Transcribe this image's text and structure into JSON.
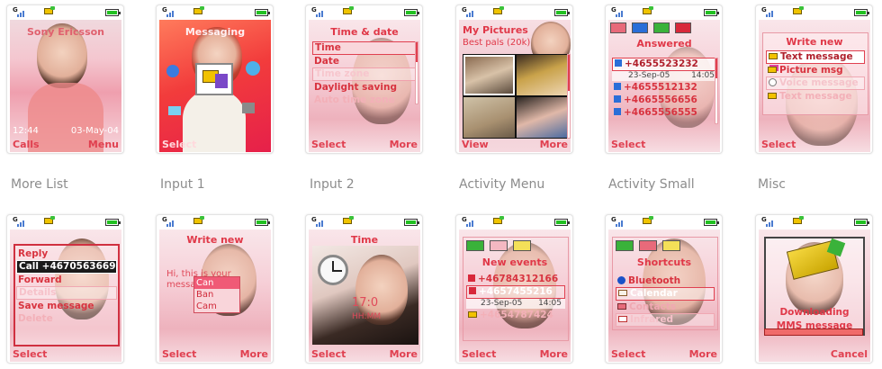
{
  "captions": [
    "More List",
    "Input 1",
    "Input 2",
    "Activity Menu",
    "Activity Small",
    "Misc"
  ],
  "standby": {
    "operator": "Sony Ericsson",
    "time": "12:44",
    "date": "03-May-04",
    "left": "Calls",
    "right": "Menu"
  },
  "messaging": {
    "title": "Messaging",
    "left": "Select"
  },
  "time_date": {
    "title": "Time & date",
    "items": [
      "Time",
      "Date",
      "Time zone",
      "Daylight saving",
      "Auto time zone"
    ],
    "left": "Select",
    "right": "More"
  },
  "pictures": {
    "title": "My Pictures",
    "subtitle": "Best pals (20k)",
    "left": "View",
    "right": "More"
  },
  "answered": {
    "title": "Answered",
    "items": [
      "+4655523232",
      "+4655523232",
      "+4655512132",
      "+4665556656",
      "+4665556555"
    ],
    "date": "23-Sep-05",
    "time": "14:05",
    "left": "Select"
  },
  "write_new": {
    "title": "Write new",
    "items": [
      "Text message",
      "Picture msg",
      "Voice message",
      "Text message"
    ],
    "left": "Select"
  },
  "more_list": {
    "items": [
      "Reply",
      "Call +4670563669",
      "Forward",
      "Details",
      "Save message",
      "Delete"
    ],
    "left": "Select"
  },
  "input1": {
    "title": "Write new",
    "body": "Hi, this is your message",
    "options": [
      "Can",
      "Ban",
      "Cam"
    ],
    "left": "Select",
    "right": "More"
  },
  "input2": {
    "title": "Time",
    "time": "17:0",
    "format": "HH:MM",
    "left": "Select",
    "right": "More"
  },
  "activity_menu": {
    "title": "New events",
    "items": [
      "+46784312166",
      "+4657455216",
      "+4654787424"
    ],
    "date": "23-Sep-05",
    "time": "14:05",
    "left": "Select",
    "right": "More"
  },
  "activity_small": {
    "title": "Shortcuts",
    "items": [
      "Bluetooth",
      "Calendar",
      "Contacts",
      "Infrared"
    ],
    "left": "Select",
    "right": "More"
  },
  "misc": {
    "line1": "Downloading",
    "line2": "MMS message",
    "right": "Cancel"
  },
  "colors": {
    "accent": "#e04050",
    "highlight_border": "#e04050",
    "status_battery": "#22c022"
  }
}
